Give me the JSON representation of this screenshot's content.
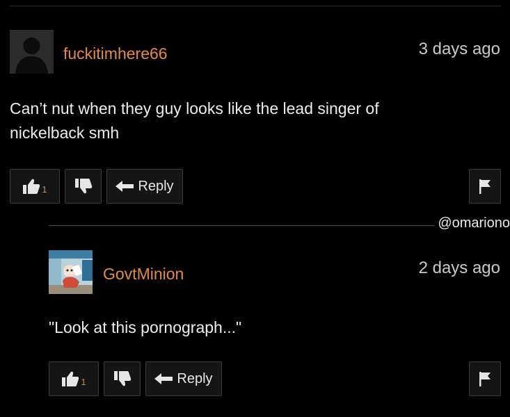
{
  "comments": [
    {
      "username": "fuckitimhere66",
      "timestamp": "3 days ago",
      "text_line1": "Can’t nut when they guy looks like the lead singer of",
      "text_line2": "nickelback smh",
      "like_count": "1",
      "reply_label": "Reply",
      "avatar_icon": "default-user-silhouette-icon"
    },
    {
      "username": "GovtMinion",
      "timestamp": "2 days ago",
      "text": "\"Look at this pornograph...\"",
      "like_count": "1",
      "reply_label": "Reply",
      "avatar_icon": "cartoon-avatar-image"
    }
  ],
  "watermark": "@omariono",
  "colors": {
    "background": "#000000",
    "username": "#e58a45",
    "like_count": "#d08a4d",
    "button_bg": "#151515",
    "button_border": "#3a3a3a"
  }
}
